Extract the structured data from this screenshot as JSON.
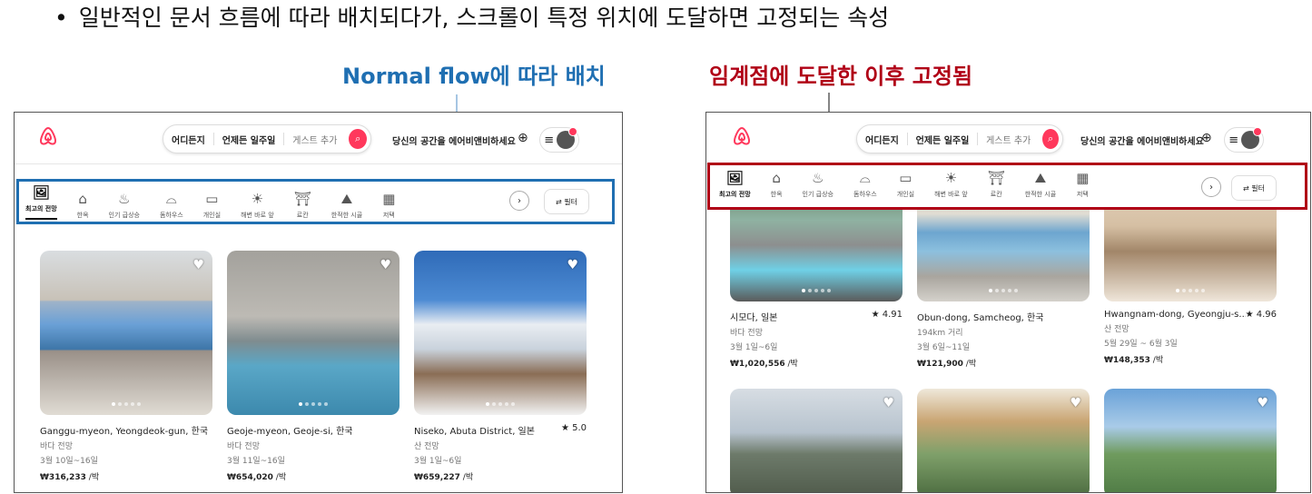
{
  "heading": {
    "bullet": "•",
    "text": "일반적인 문서 흐름에 따라 배치되다가, 스크롤이 특정 위치에 도달하면 고정되는 속성"
  },
  "labels": {
    "normal": "Normal flow에 따라 배치",
    "fixed": "임계점에 도달한 이후 고정됨"
  },
  "colors": {
    "blue": "#1f6fb2",
    "red": "#b00016",
    "brand": "#ff385c"
  },
  "header": {
    "logo_icon": "airbnb-logo",
    "search": {
      "where": "어디든지",
      "when": "언제든 일주일",
      "guests": "게스트 추가",
      "icon": "search-icon"
    },
    "host": "당신의 공간을 에어비앤비하세요",
    "globe_icon": "globe-icon",
    "menu_icon": "menu-icon"
  },
  "categories": [
    {
      "label": "최고의 전망",
      "icon": "view-icon",
      "active": true
    },
    {
      "label": "한옥",
      "icon": "hanok-icon"
    },
    {
      "label": "인기 급상승",
      "icon": "flame-icon"
    },
    {
      "label": "돔하우스",
      "icon": "dome-icon"
    },
    {
      "label": "개인실",
      "icon": "room-icon"
    },
    {
      "label": "해변 바로 앞",
      "icon": "beach-icon"
    },
    {
      "label": "료칸",
      "icon": "ryokan-icon"
    },
    {
      "label": "한적한 시골",
      "icon": "countryside-icon"
    },
    {
      "label": "저택",
      "icon": "mansion-icon"
    }
  ],
  "filter": {
    "label": "필터",
    "icon": "filter-icon"
  },
  "left_listings": [
    {
      "location": "Ganggu-myeon, Yeongdeok-gun, 한국",
      "rating": "",
      "subtitle": "바다 전망",
      "dates": "3월 10일~16일",
      "price": "₩316,233",
      "unit": " /박"
    },
    {
      "location": "Geoje-myeon, Geoje-si, 한국",
      "rating": "",
      "subtitle": "바다 전망",
      "dates": "3월 11일~16일",
      "price": "₩654,020",
      "unit": " /박"
    },
    {
      "location": "Niseko, Abuta District, 일본",
      "rating": "★ 5.0",
      "subtitle": "산 전망",
      "dates": "3월 1일~6일",
      "price": "₩659,227",
      "unit": " /박"
    }
  ],
  "right_listings": [
    {
      "location": "시모다, 일본",
      "rating": "★ 4.91",
      "subtitle": "바다 전망",
      "dates": "3월 1일~6일",
      "price": "₩1,020,556",
      "unit": " /박"
    },
    {
      "location": "Obun-dong, Samcheog, 한국",
      "rating": "",
      "subtitle": "194km 거리",
      "dates": "3월 6일~11일",
      "price": "₩121,900",
      "unit": " /박"
    },
    {
      "location": "Hwangnam-dong, Gyeongju-s...",
      "rating": "★ 4.96",
      "subtitle": "산 전망",
      "dates": "5월 29일 ~ 6월 3일",
      "price": "₩148,353",
      "unit": " /박"
    }
  ]
}
